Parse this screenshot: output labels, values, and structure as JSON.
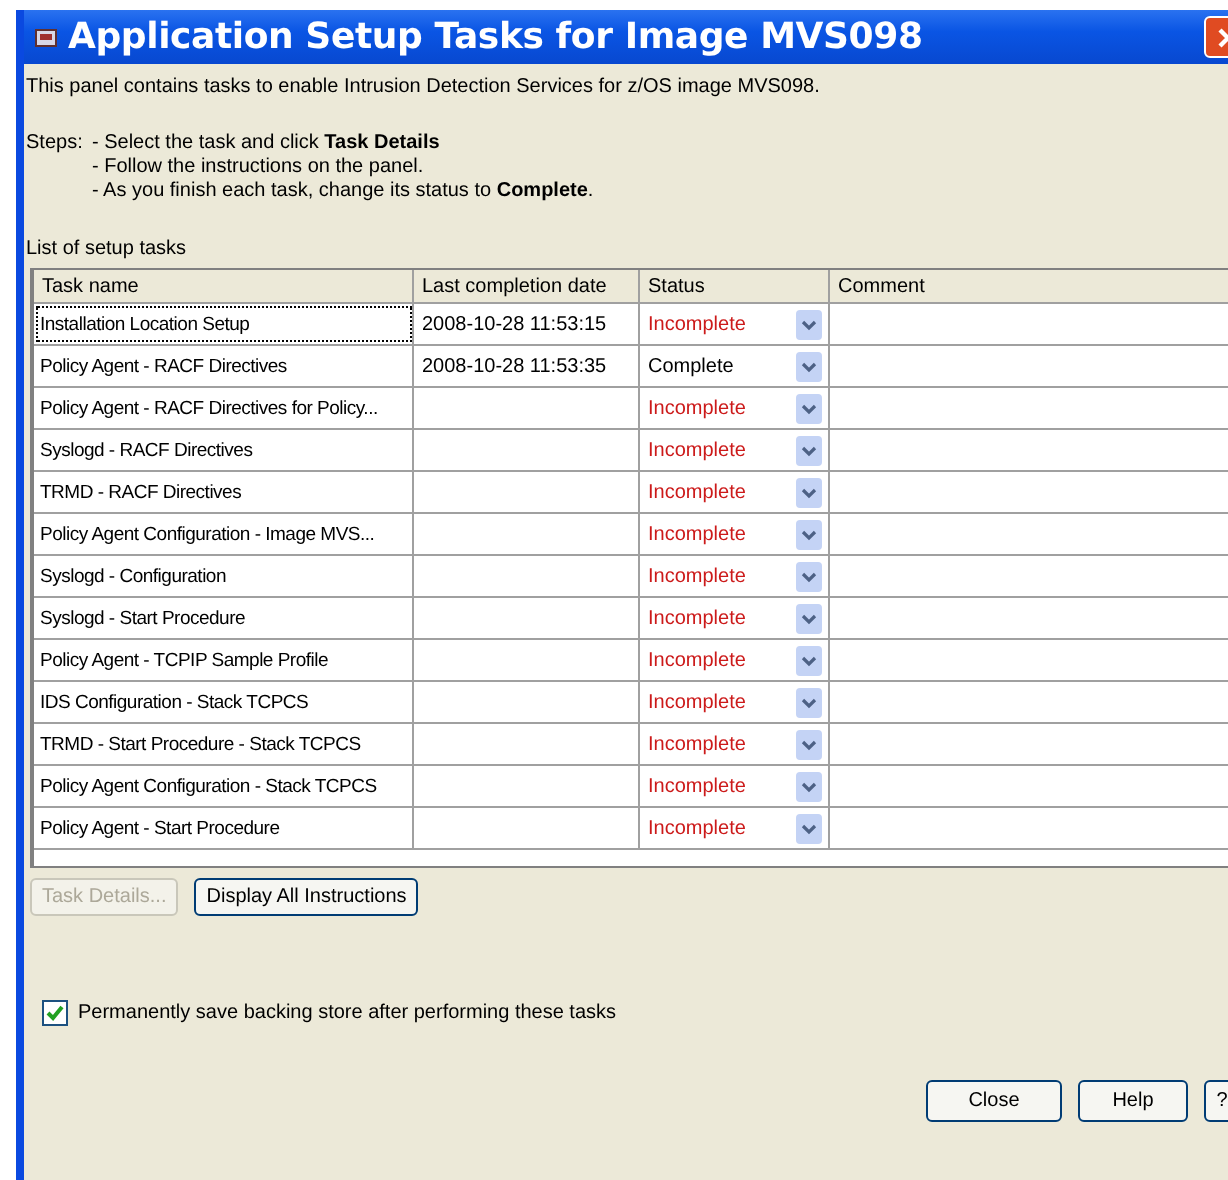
{
  "window": {
    "title": "Application Setup Tasks for Image MVS098"
  },
  "description": "This panel contains tasks to enable Intrusion Detection Services for z/OS image MVS098.",
  "steps_label": "Steps:",
  "steps": [
    "- Select the task and click **Task Details**",
    "- Follow the instructions on the panel.",
    "- As you finish each task, change its status to **Complete**."
  ],
  "list_label": "List of setup tasks",
  "table": {
    "columns": [
      "Task name",
      "Last completion date",
      "Status",
      "Comment"
    ],
    "rows": [
      {
        "task": "Installation Location Setup",
        "date": "2008-10-28 11:53:15",
        "status": "Incomplete",
        "complete": false,
        "selected": true
      },
      {
        "task": "Policy Agent - RACF Directives",
        "date": "2008-10-28 11:53:35",
        "status": "Complete",
        "complete": true,
        "selected": false
      },
      {
        "task": "Policy Agent - RACF Directives for Policy...",
        "status": "Incomplete",
        "complete": false,
        "selected": false
      },
      {
        "task": "Syslogd - RACF Directives",
        "status": "Incomplete",
        "complete": false,
        "selected": false
      },
      {
        "task": "TRMD - RACF Directives",
        "status": "Incomplete",
        "complete": false,
        "selected": false
      },
      {
        "task": "Policy Agent Configuration - Image MVS...",
        "status": "Incomplete",
        "complete": false,
        "selected": false
      },
      {
        "task": "Syslogd - Configuration",
        "status": "Incomplete",
        "complete": false,
        "selected": false
      },
      {
        "task": "Syslogd - Start Procedure",
        "status": "Incomplete",
        "complete": false,
        "selected": false
      },
      {
        "task": "Policy Agent - TCPIP Sample Profile",
        "status": "Incomplete",
        "complete": false,
        "selected": false
      },
      {
        "task": "IDS Configuration - Stack TCPCS",
        "status": "Incomplete",
        "complete": false,
        "selected": false
      },
      {
        "task": "TRMD - Start Procedure - Stack TCPCS",
        "status": "Incomplete",
        "complete": false,
        "selected": false
      },
      {
        "task": "Policy Agent Configuration - Stack TCPCS",
        "status": "Incomplete",
        "complete": false,
        "selected": false
      },
      {
        "task": "Policy Agent - Start Procedure",
        "status": "Incomplete",
        "complete": false,
        "selected": false
      }
    ]
  },
  "action_buttons": [
    {
      "label": "Task Details...",
      "disabled": true
    },
    {
      "label": "Display All Instructions",
      "disabled": false
    }
  ],
  "save_option": {
    "label": "Permanently save backing store after performing these tasks",
    "checked": true
  },
  "footer_buttons": [
    "Close",
    "Help",
    "?"
  ]
}
